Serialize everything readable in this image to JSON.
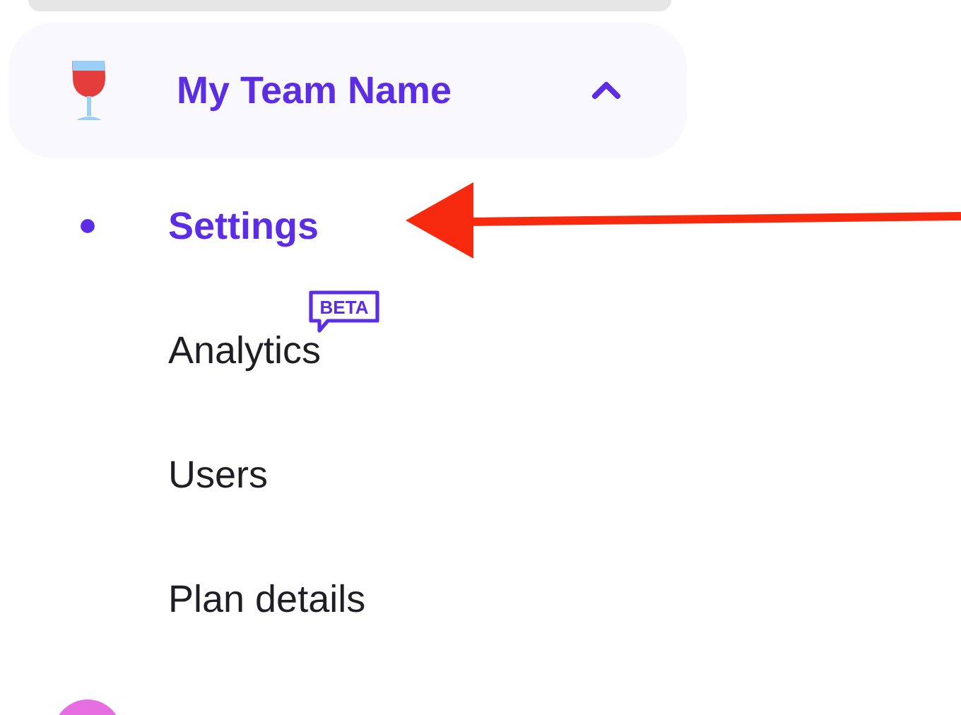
{
  "team": {
    "name": "My Team Name",
    "expanded": true,
    "items": [
      {
        "label": "Settings",
        "selected": true
      },
      {
        "label": "Analytics",
        "selected": false,
        "badge": "BETA"
      },
      {
        "label": "Users",
        "selected": false
      },
      {
        "label": "Plan details",
        "selected": false
      }
    ]
  }
}
